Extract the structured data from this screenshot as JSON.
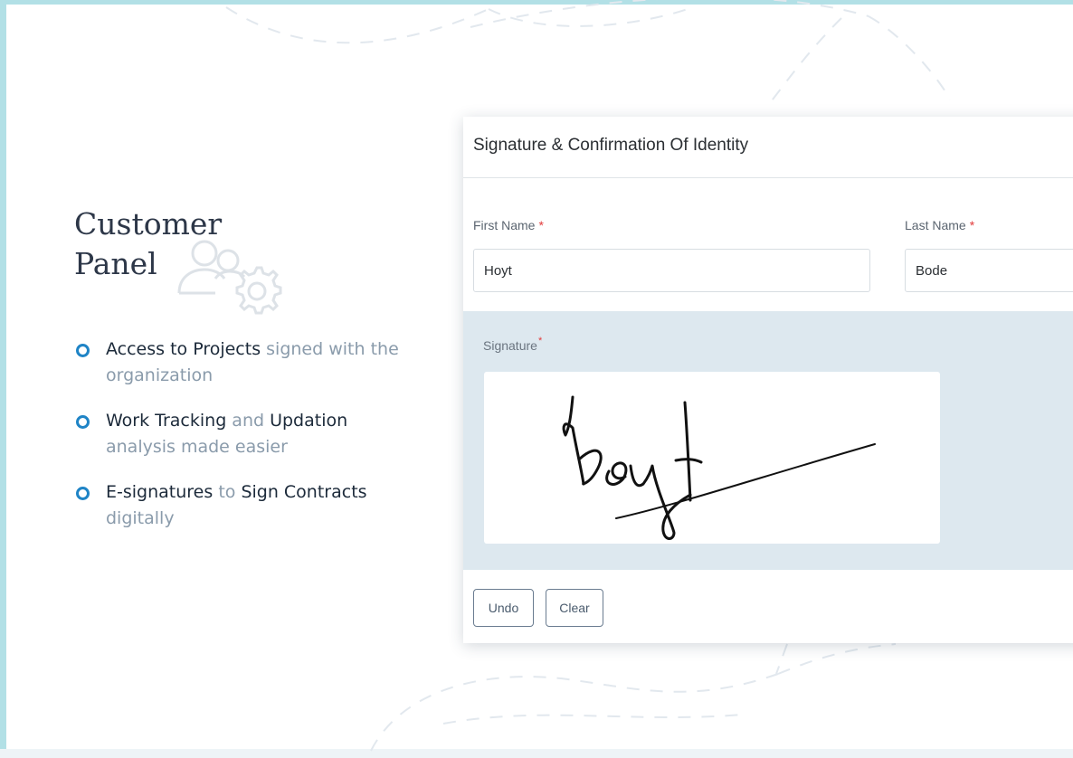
{
  "panel": {
    "title_line1": "Customer",
    "title_line2": "Panel",
    "features": [
      {
        "parts": [
          {
            "text": "Access to Projects ",
            "style": "strong"
          },
          {
            "text": "signed with the organization",
            "style": "muted"
          }
        ]
      },
      {
        "parts": [
          {
            "text": "Work Tracking ",
            "style": "strong"
          },
          {
            "text": "and ",
            "style": "muted"
          },
          {
            "text": "Updation ",
            "style": "strong"
          },
          {
            "text": "analysis made easier",
            "style": "muted"
          }
        ]
      },
      {
        "parts": [
          {
            "text": "E-signatures ",
            "style": "strong"
          },
          {
            "text": "to ",
            "style": "muted"
          },
          {
            "text": "Sign Contracts ",
            "style": "strong"
          },
          {
            "text": "digitally",
            "style": "muted"
          }
        ]
      }
    ]
  },
  "form": {
    "title": "Signature & Confirmation Of Identity",
    "first_name": {
      "label": "First Name",
      "required_mark": "*",
      "value": "Hoyt"
    },
    "last_name": {
      "label": "Last Name",
      "required_mark": "*",
      "value": "Bode"
    },
    "signature": {
      "label": "Signature",
      "required_mark": "*",
      "drawn_name": "Hoyt"
    },
    "buttons": {
      "undo": "Undo",
      "clear": "Clear"
    }
  },
  "colors": {
    "frame": "#b2e0e6",
    "accent": "#1f84c6",
    "signature_bg": "#dde8ef",
    "required": "#e23b3b"
  },
  "icons": [
    "users-gear-icon",
    "bullet-circle-icon"
  ]
}
